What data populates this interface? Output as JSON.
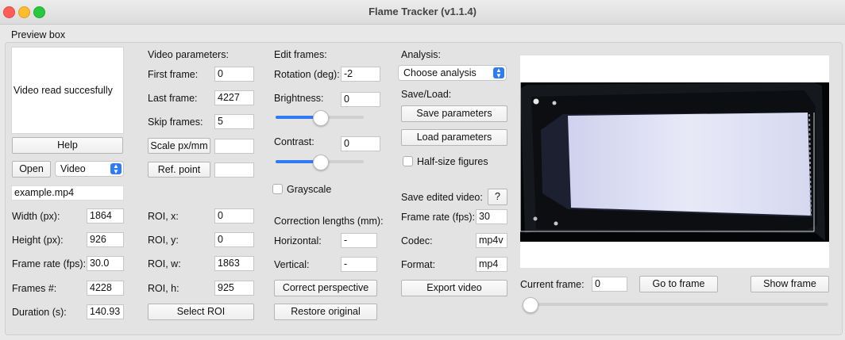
{
  "window": {
    "title": "Flame Tracker (v1.1.4)"
  },
  "preview_box": {
    "label": "Preview box"
  },
  "left": {
    "message": "Video read succesfully",
    "help": "Help",
    "open": "Open",
    "source": "Video",
    "filename": "example.mp4",
    "info": [
      {
        "label": "Width (px):",
        "value": "1864"
      },
      {
        "label": "Height (px):",
        "value": "926"
      },
      {
        "label": "Frame rate (fps):",
        "value": "30.0"
      },
      {
        "label": "Frames #:",
        "value": "4228"
      },
      {
        "label": "Duration (s):",
        "value": "140.93"
      }
    ]
  },
  "video_params": {
    "heading": "Video parameters:",
    "first_frame": {
      "label": "First frame:",
      "value": "0"
    },
    "last_frame": {
      "label": "Last frame:",
      "value": "4227"
    },
    "skip_frames": {
      "label": "Skip frames:",
      "value": "5"
    },
    "scale_button": "Scale px/mm",
    "scale_value": "",
    "ref_button": "Ref. point",
    "ref_value": "",
    "roi": [
      {
        "label": "ROI, x:",
        "value": "0"
      },
      {
        "label": "ROI, y:",
        "value": "0"
      },
      {
        "label": "ROI, w:",
        "value": "1863"
      },
      {
        "label": "ROI, h:",
        "value": "925"
      }
    ],
    "select_roi": "Select ROI"
  },
  "edit_frames": {
    "heading": "Edit frames:",
    "rotation": {
      "label": "Rotation (deg):",
      "value": "-2"
    },
    "brightness": {
      "label": "Brightness:",
      "value": "0",
      "level": 0.5
    },
    "contrast": {
      "label": "Contrast:",
      "value": "0",
      "level": 0.5
    },
    "grayscale": {
      "label": "Grayscale",
      "checked": false
    },
    "correction_heading": "Correction lengths (mm):",
    "horizontal": {
      "label": "Horizontal:",
      "value": "-"
    },
    "vertical": {
      "label": "Vertical:",
      "value": "-"
    },
    "correct_perspective": "Correct perspective",
    "restore_original": "Restore original"
  },
  "analysis": {
    "heading": "Analysis:",
    "choose": "Choose analysis",
    "save_load": "Save/Load:",
    "save_params": "Save parameters",
    "load_params": "Load parameters",
    "half_size": {
      "label": "Half-size figures",
      "checked": false
    },
    "save_video_label": "Save edited video:",
    "help_q": "?",
    "frame_rate": {
      "label": "Frame rate (fps):",
      "value": "30"
    },
    "codec": {
      "label": "Codec:",
      "value": "mp4v"
    },
    "format": {
      "label": "Format:",
      "value": "mp4"
    },
    "export": "Export video"
  },
  "frame_nav": {
    "current_label": "Current frame:",
    "current_value": "0",
    "go_to": "Go to frame",
    "show": "Show frame",
    "position": 0
  },
  "colors": {
    "accent": "#2f7bf5",
    "sample": "#e6e8f6",
    "frame": "#040506"
  }
}
